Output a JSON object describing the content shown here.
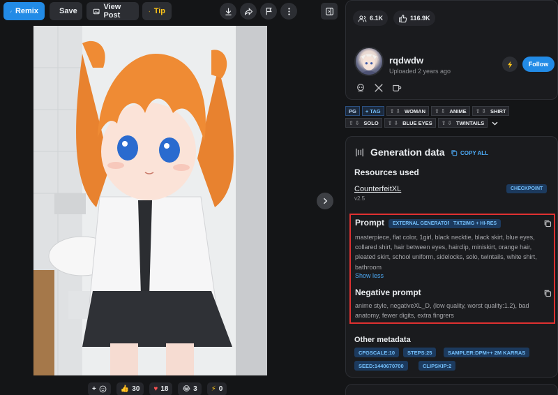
{
  "toolbar": {
    "remix": "Remix",
    "save": "Save",
    "view_post": "View Post",
    "tip": "Tip"
  },
  "reactions": {
    "add_label": "+",
    "like": "30",
    "heart": "18",
    "laugh": "3",
    "buzz": "0"
  },
  "stats": {
    "followers": "6.1K",
    "likes": "116.9K"
  },
  "user": {
    "name": "rqdwdw",
    "uploaded": "Uploaded 2 years ago",
    "follow": "Follow"
  },
  "tags": {
    "rating": "PG",
    "add": "+ TAG",
    "items": [
      "WOMAN",
      "ANIME",
      "SHIRT",
      "SOLO",
      "BLUE EYES",
      "TWINTAILS"
    ]
  },
  "generation": {
    "title": "Generation data",
    "copy_all": "COPY ALL",
    "resources_title": "Resources used",
    "resource_name": "CounterfeitXL",
    "resource_version": "v2.5",
    "resource_type": "CHECKPOINT",
    "prompt_title": "Prompt",
    "prompt_badges": [
      "EXTERNAL GENERATOR",
      "TXT2IMG + HI-RES"
    ],
    "prompt_text": "masterpiece, flat color, 1girl, black necktie, black skirt, blue eyes, collared shirt, hair between eyes, hairclip, miniskirt, orange hair, pleated skirt, school uniform, sidelocks, solo, twintails, white shirt, bathroom",
    "show_less": "Show less",
    "negative_title": "Negative prompt",
    "negative_text": "anime style, negativeXL_D, (low quality, worst quality:1.2), bad anatomy, fewer digits, extra fingrers",
    "meta_title": "Other metadata",
    "meta": [
      "CFGSCALE:10",
      "STEPS:25",
      "SAMPLER:DPM++ 2M KARRAS",
      "SEED:1440670700",
      "CLIPSKIP:2"
    ]
  },
  "colors": {
    "accent": "#228be6",
    "highlight_border": "#e03131",
    "tip": "#fcc419"
  }
}
